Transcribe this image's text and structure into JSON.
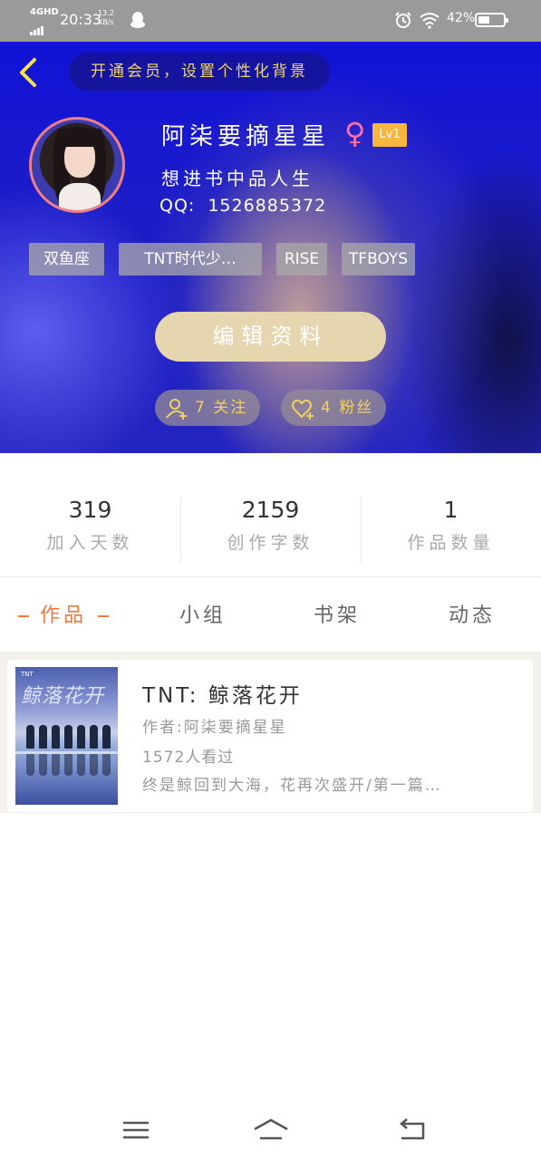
{
  "status_bar": {
    "network": "4GHD",
    "time": "20:33",
    "speed_value": "13.2",
    "speed_unit": "KB/s",
    "battery": "42%",
    "icons": [
      "signal-icon",
      "qq-icon",
      "alarm-icon",
      "wifi-icon",
      "battery-icon"
    ]
  },
  "header": {
    "vip_banner": "开通会员，设置个性化背景",
    "username": "阿柒要摘星星",
    "gender_symbol": "♀",
    "level": "Lv1",
    "signature": "想进书中品人生",
    "qq_label": "QQ:",
    "qq_number": "1526885372",
    "tags": [
      "双鱼座",
      "TNT时代少…",
      "RISE",
      "TFBOYS"
    ],
    "edit_button": "编辑资料",
    "follow_text": "7 关注",
    "fans_text": "4 粉丝",
    "accent_color": "#f3d05f"
  },
  "stats": [
    {
      "value": "319",
      "label": "加入天数"
    },
    {
      "value": "2159",
      "label": "创作字数"
    },
    {
      "value": "1",
      "label": "作品数量"
    }
  ],
  "tabs": [
    {
      "label": "作品",
      "active": true
    },
    {
      "label": "小组",
      "active": false
    },
    {
      "label": "书架",
      "active": false
    },
    {
      "label": "动态",
      "active": false
    }
  ],
  "works": [
    {
      "title": "TNT: 鲸落花开",
      "author": "作者:阿柒要摘星星",
      "views": "1572人看过",
      "description": "终是鲸回到大海，花再次盛开/第一篇…",
      "cover_title": "鲸落花开",
      "cover_brand": "TNT"
    }
  ],
  "nav": [
    "menu-icon",
    "home-icon",
    "back-icon"
  ]
}
